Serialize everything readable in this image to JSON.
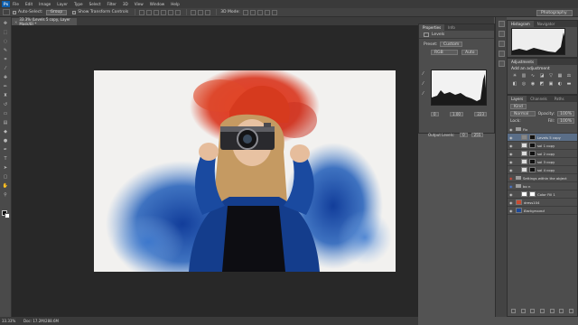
{
  "menubar": {
    "logo": "Ps",
    "items": [
      "File",
      "Edit",
      "Image",
      "Layer",
      "Type",
      "Select",
      "Filter",
      "3D",
      "View",
      "Window",
      "Help"
    ]
  },
  "options": {
    "auto_select": "Auto-Select:",
    "auto_select_value": "Group",
    "show_transform": "Show Transform Controls",
    "mode3d": "3D Mode:",
    "workspace": "Photography"
  },
  "document_tab": {
    "title": "33.3% (Levels 5 copy, Layer Mask/8) *"
  },
  "status": {
    "zoom": "33.33%",
    "doc": "Doc: 17.2M/288.6M"
  },
  "properties": {
    "tab_properties": "Properties",
    "tab_info": "Info",
    "adjustment": "Levels",
    "preset_label": "Preset:",
    "preset_value": "Custom",
    "channel": "RGB",
    "auto_button": "Auto",
    "input_black": "0",
    "input_mid": "1.00",
    "input_white": "223",
    "output_label": "Output Levels:",
    "output_black": "0",
    "output_white": "255"
  },
  "histogram_panel": {
    "tab_histogram": "Histogram",
    "tab_navigator": "Navigator"
  },
  "adjustments": {
    "tab": "Adjustments",
    "title": "Add an adjustment"
  },
  "layers_panel": {
    "tab_layers": "Layers",
    "tab_channels": "Channels",
    "tab_paths": "Paths",
    "kind": "Kind",
    "blend_mode": "Normal",
    "opacity_label": "Opacity:",
    "opacity": "100%",
    "lock_label": "Lock:",
    "fill_label": "Fill:",
    "fill": "100%",
    "layers": [
      {
        "name": "Fix",
        "type": "group",
        "selected": false
      },
      {
        "name": "Levels 5 copy",
        "type": "adjustment",
        "selected": true
      },
      {
        "name": "sol 1 copy",
        "type": "layer",
        "selected": false
      },
      {
        "name": "sol 2 copy",
        "type": "layer",
        "selected": false
      },
      {
        "name": "sol 3 copy",
        "type": "layer",
        "selected": false
      },
      {
        "name": "sol 4 copy",
        "type": "layer",
        "selected": false
      },
      {
        "name": "Settings within the object",
        "type": "group",
        "selected": false
      },
      {
        "name": "bo n",
        "type": "group",
        "selected": false
      },
      {
        "name": "Color Fill 1",
        "type": "fill",
        "selected": false
      },
      {
        "name": "dress104",
        "type": "layer",
        "selected": false
      },
      {
        "name": "Background",
        "type": "background",
        "selected": false
      }
    ]
  },
  "colors": {
    "accent_selection": "#5a6e88",
    "photo_red": "#d93a22",
    "photo_blue": "#1c56b0"
  }
}
